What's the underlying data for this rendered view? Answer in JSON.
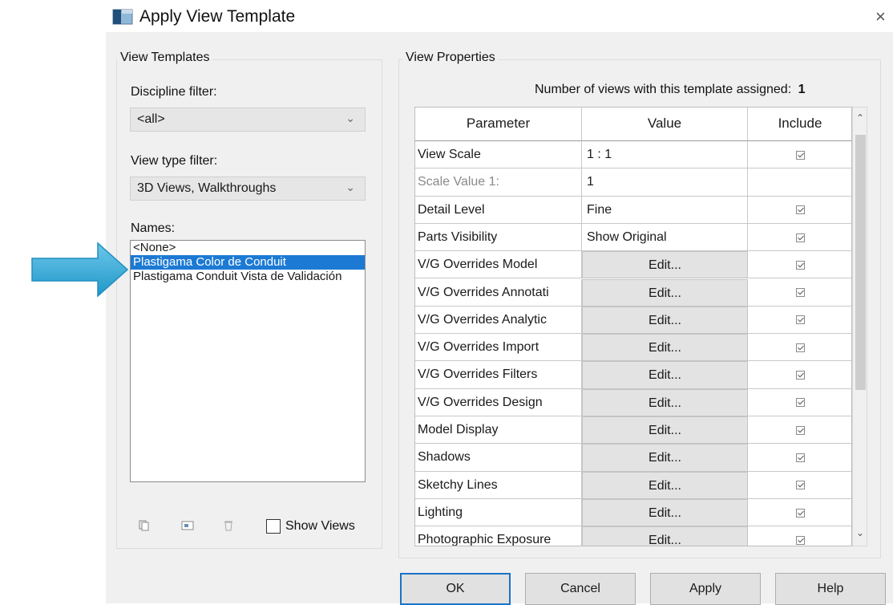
{
  "window": {
    "title": "Apply View Template",
    "close_glyph": "×"
  },
  "left_panel": {
    "group_title": "View Templates",
    "discipline_label": "Discipline filter:",
    "discipline_value": "<all>",
    "viewtype_label": "View type filter:",
    "viewtype_value": "3D Views, Walkthroughs",
    "names_label": "Names:",
    "names": [
      "<None>",
      "Plastigama Color de Conduit",
      "Plastigama Conduit Vista de Validación"
    ],
    "selected_index": 1,
    "tool_icons": [
      "duplicate-icon",
      "rename-icon",
      "delete-icon"
    ],
    "show_views_label": "Show Views",
    "show_views_checked": false
  },
  "right_panel": {
    "group_title": "View Properties",
    "assigned_label": "Number of views with this template assigned:",
    "assigned_count": "1",
    "columns": [
      "Parameter",
      "Value",
      "Include"
    ],
    "rows": [
      {
        "parameter": "View Scale",
        "value": "1 : 1",
        "include": true
      },
      {
        "parameter": "Scale Value    1:",
        "value": "1",
        "include": false,
        "disabled": true
      },
      {
        "parameter": "Detail Level",
        "value": "Fine",
        "include": true
      },
      {
        "parameter": "Parts Visibility",
        "value": "Show Original",
        "include": true
      },
      {
        "parameter": "V/G Overrides Model",
        "value": "Edit...",
        "include": true,
        "button": true
      },
      {
        "parameter": "V/G Overrides Annotati",
        "value": "Edit...",
        "include": true,
        "button": true
      },
      {
        "parameter": "V/G Overrides Analytic",
        "value": "Edit...",
        "include": true,
        "button": true
      },
      {
        "parameter": "V/G Overrides Import",
        "value": "Edit...",
        "include": true,
        "button": true
      },
      {
        "parameter": "V/G Overrides Filters",
        "value": "Edit...",
        "include": true,
        "button": true
      },
      {
        "parameter": "V/G Overrides Design",
        "value": "Edit...",
        "include": true,
        "button": true
      },
      {
        "parameter": "Model Display",
        "value": "Edit...",
        "include": true,
        "button": true
      },
      {
        "parameter": "Shadows",
        "value": "Edit...",
        "include": true,
        "button": true
      },
      {
        "parameter": "Sketchy Lines",
        "value": "Edit...",
        "include": true,
        "button": true
      },
      {
        "parameter": "Lighting",
        "value": "Edit...",
        "include": true,
        "button": true
      },
      {
        "parameter": "Photographic Exposure",
        "value": "Edit...",
        "include": true,
        "button": true
      }
    ]
  },
  "buttons": {
    "ok": "OK",
    "cancel": "Cancel",
    "apply": "Apply",
    "help": "Help"
  },
  "colors": {
    "accent": "#1c7ad4",
    "annotation_arrow": "#2fa9d6",
    "dialog_bg": "#f0f0f0"
  }
}
